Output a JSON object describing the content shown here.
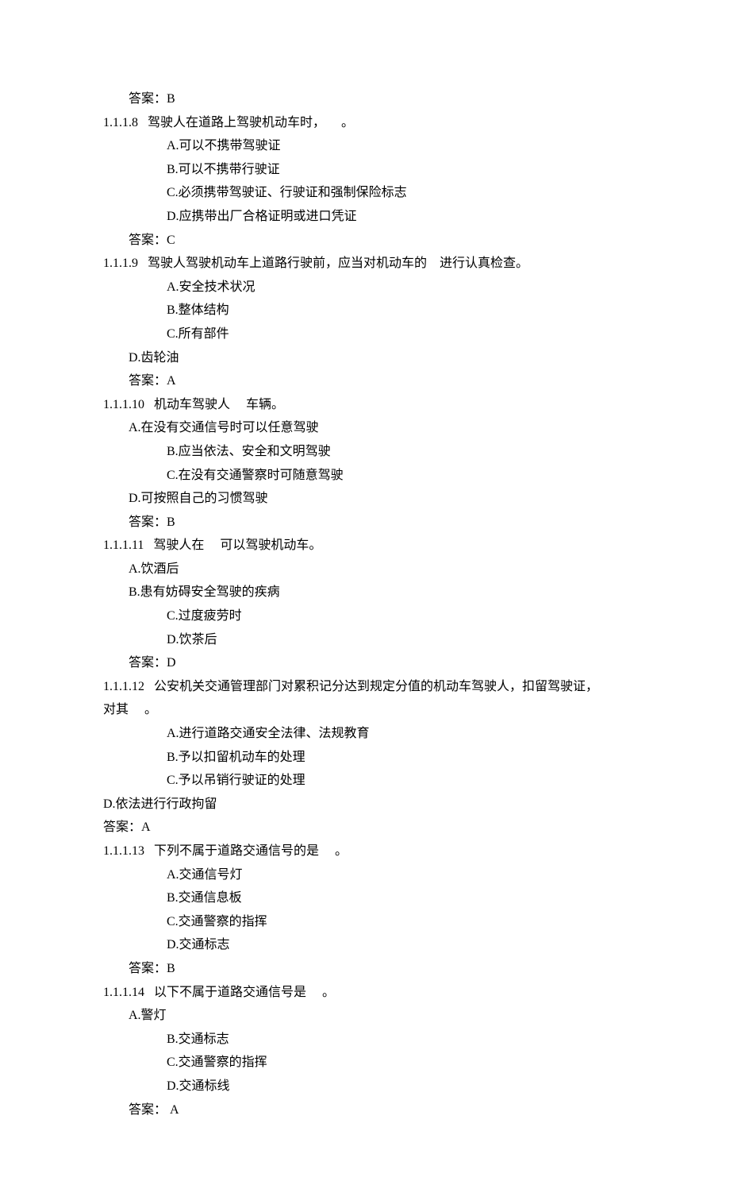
{
  "q7_answer": "答案：B",
  "q8": {
    "number": "1.1.1.8",
    "stem": "驾驶人在道路上驾驶机动车时，",
    "tail": "。",
    "a": "A.可以不携带驾驶证",
    "b": "B.可以不携带行驶证",
    "c": "C.必须携带驾驶证、行驶证和强制保险标志",
    "d": "D.应携带出厂合格证明或进口凭证",
    "answer": "答案：C"
  },
  "q9": {
    "number": "1.1.1.9",
    "stem": "驾驶人驾驶机动车上道路行驶前，应当对机动车的",
    "tail": "进行认真检查。",
    "a": "A.安全技术状况",
    "b": "B.整体结构",
    "c": "C.所有部件",
    "d": "D.齿轮油",
    "answer": "答案：A"
  },
  "q10": {
    "number": "1.1.1.10",
    "stem": "机动车驾驶人",
    "tail": "车辆。",
    "a": "A.在没有交通信号时可以任意驾驶",
    "b": "B.应当依法、安全和文明驾驶",
    "c": "C.在没有交通警察时可随意驾驶",
    "d": "D.可按照自己的习惯驾驶",
    "answer": "答案：B"
  },
  "q11": {
    "number": "1.1.1.11",
    "stem": "驾驶人在",
    "tail": "可以驾驶机动车。",
    "a": "A.饮酒后",
    "b": "B.患有妨碍安全驾驶的疾病",
    "c": "C.过度疲劳时",
    "d": "D.饮茶后",
    "answer": "答案：D"
  },
  "q12": {
    "number": "1.1.1.12",
    "stem": "公安机关交通管理部门对累积记分达到规定分值的机动车驾驶人，扣留驾驶证，",
    "line2_pre": "对其",
    "line2_post": "。",
    "a": "A.进行道路交通安全法律、法规教育",
    "b": "B.予以扣留机动车的处理",
    "c": "C.予以吊销行驶证的处理",
    "d": "D.依法进行行政拘留",
    "answer": "答案：A"
  },
  "q13": {
    "number": "1.1.1.13",
    "stem": "下列不属于道路交通信号的是",
    "tail": "。",
    "a": "A.交通信号灯",
    "b": "B.交通信息板",
    "c": "C.交通警察的指挥",
    "d": "D.交通标志",
    "answer": "答案：B"
  },
  "q14": {
    "number": "1.1.1.14",
    "stem": "以下不属于道路交通信号是",
    "tail": "。",
    "a": "A.警灯",
    "b": "B.交通标志",
    "c": "C.交通警察的指挥",
    "d": "D.交通标线",
    "answer": "答案： A"
  }
}
